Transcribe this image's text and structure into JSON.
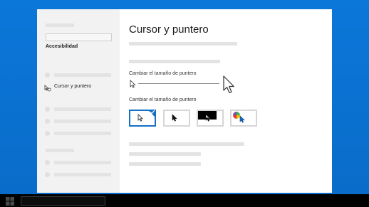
{
  "window": {
    "title": "Cursor y puntero"
  },
  "sidebar": {
    "section_label": "Accesibilidad",
    "selected_item_label": "Cursor y puntero",
    "selected_item_icon": "cursor-hand-icon"
  },
  "main": {
    "size_label": "Cambiar el tamaño de puntero",
    "style_label": "Cambiar el tamaño de puntero",
    "style_options": [
      {
        "name": "white-pointer",
        "selected": true
      },
      {
        "name": "black-pointer",
        "selected": false
      },
      {
        "name": "inverted-pointer",
        "selected": false
      },
      {
        "name": "custom-color-pointer",
        "selected": false
      }
    ]
  },
  "colors": {
    "accent": "#1570c8",
    "desktop": "#0a6fd0",
    "sidebar_bg": "#f2f2f2"
  }
}
